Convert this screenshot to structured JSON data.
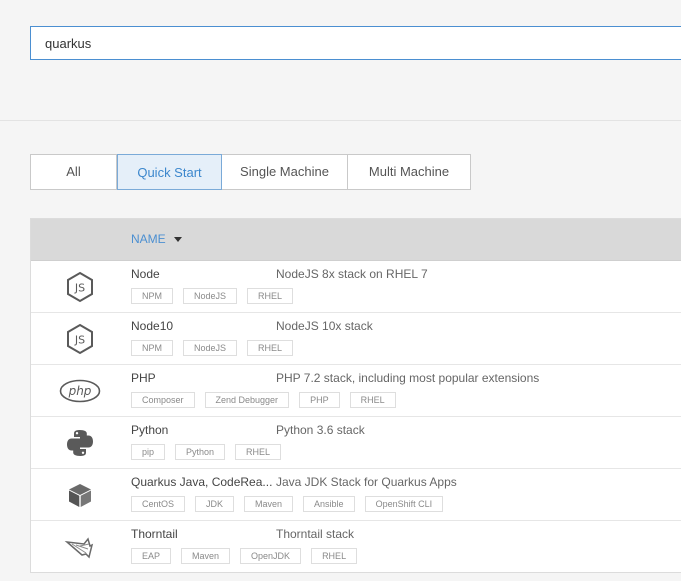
{
  "search": {
    "value": "quarkus"
  },
  "tabs": [
    {
      "label": "All",
      "active": false
    },
    {
      "label": "Quick Start",
      "active": true
    },
    {
      "label": "Single Machine",
      "active": false
    },
    {
      "label": "Multi Machine",
      "active": false
    }
  ],
  "table": {
    "header": {
      "name_label": "NAME",
      "sort_icon": "caret-down-icon"
    },
    "rows": [
      {
        "name": "Node",
        "description": "NodeJS 8x stack on RHEL 7",
        "icon": "nodejs-icon",
        "tags": [
          "NPM",
          "NodeJS",
          "RHEL"
        ]
      },
      {
        "name": "Node10",
        "description": "NodeJS 10x stack",
        "icon": "nodejs-icon",
        "tags": [
          "NPM",
          "NodeJS",
          "RHEL"
        ]
      },
      {
        "name": "PHP",
        "description": "PHP 7.2 stack, including most popular extensions",
        "icon": "php-icon",
        "tags": [
          "Composer",
          "Zend Debugger",
          "PHP",
          "RHEL"
        ]
      },
      {
        "name": "Python",
        "description": "Python 3.6 stack",
        "icon": "python-icon",
        "tags": [
          "pip",
          "Python",
          "RHEL"
        ]
      },
      {
        "name": "Quarkus Java, CodeRea...",
        "description": "Java JDK Stack for Quarkus Apps",
        "icon": "cube-icon",
        "tags": [
          "CentOS",
          "JDK",
          "Maven",
          "Ansible",
          "OpenShift CLI"
        ]
      },
      {
        "name": "Thorntail",
        "description": "Thorntail stack",
        "icon": "thorntail-icon",
        "tags": [
          "EAP",
          "Maven",
          "OpenJDK",
          "RHEL"
        ]
      }
    ]
  },
  "colors": {
    "accent": "#4b8fd1",
    "header_bg": "#d9d9d9",
    "icon_gray": "#5a5a5a"
  }
}
